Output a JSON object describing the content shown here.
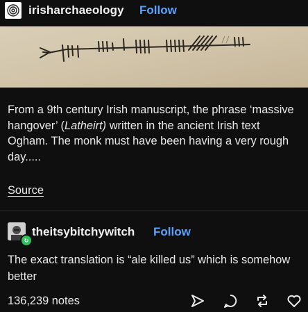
{
  "post": {
    "author": "irisharchaeology",
    "follow_label": "Follow",
    "text_part1": "From a 9th century Irish manuscript, the phrase ‘massive hangover’ (",
    "text_italic": "Latheirt)",
    "text_part2": " written in the ancient Irish text Ogham. The monk must have been having a very rough day.....",
    "source_label": "Source"
  },
  "reblog": {
    "author": "theitsybitchywitch",
    "follow_label": "Follow",
    "text": "The exact translation is “ale killed us” which is somehow better"
  },
  "footer": {
    "notes": "136,239 notes",
    "icons": [
      "share-icon",
      "reply-icon",
      "reblog-icon",
      "like-icon"
    ]
  },
  "colors": {
    "background": "#0f0f10",
    "accent": "#5aa3ff",
    "badge": "#2ec05c",
    "parchment": "#d8cbb3"
  }
}
